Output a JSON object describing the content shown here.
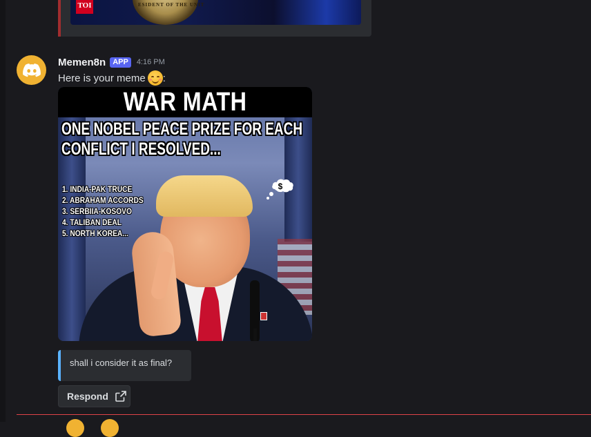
{
  "previous_embed": {
    "thumbnail_badge": "TOI",
    "thumbnail_seal_text": "ESIDENT OF THE UNIT"
  },
  "message": {
    "author": "Memen8n",
    "badge": "APP",
    "timestamp": "4:16 PM",
    "text": "Here is your meme",
    "text_suffix": ":",
    "emoji": "smiling-face-with-smiling-eyes",
    "avatar_icon": "discord-logo-icon",
    "avatar_color": "#f0b232"
  },
  "meme": {
    "title": "WAR MATH",
    "subtitle_lines": [
      "ONE NOBEL PEACE PRIZE FOR EACH",
      "CONFLICT I RESOLVED..."
    ],
    "list": [
      "1. INDIA-PAK TRUCE",
      "2. ABRAHAM ACCORDS",
      "3. SERBIIA-KOSOVO",
      "4. TALIBAN DEAL",
      "5. NORTH KOREA..."
    ],
    "thought_bubble": "$"
  },
  "reply": {
    "text": "shall i consider it as final?"
  },
  "respond_button": {
    "label": "Respond",
    "icon": "external-link-icon"
  },
  "colors": {
    "background": "#1a1a1e",
    "accent": "#5865f2",
    "embed_border": "#a12d2f",
    "reply_border": "#5ab2ff",
    "new_messages_line": "#e04349"
  }
}
